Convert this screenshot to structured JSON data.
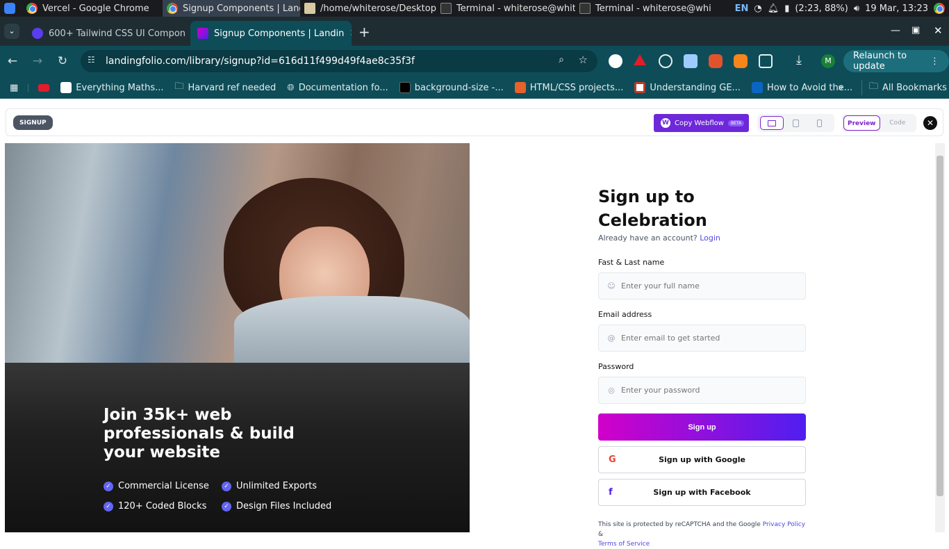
{
  "taskbar": {
    "apps": [
      {
        "label": "Vercel - Google Chrome"
      },
      {
        "label": "Signup Components | Landi..."
      },
      {
        "label": "/home/whiterose/Desktop/p..."
      },
      {
        "label": "Terminal - whiterose@white..."
      },
      {
        "label": "Terminal - whiterose@white..."
      }
    ],
    "lang": "EN",
    "battery": "(2:23, 88%)",
    "datetime": "19 Mar, 13:23"
  },
  "browser": {
    "tabs": [
      {
        "label": "600+ Tailwind CSS UI Compon"
      },
      {
        "label": "Signup Components | Landin"
      }
    ],
    "url": "landingfolio.com/library/signup?id=616d11f499d49f4ae8c35f3f",
    "relaunch": "Relaunch to update",
    "profile": "M",
    "bookmarks": [
      {
        "label": "Everything Maths..."
      },
      {
        "label": "Harvard ref needed"
      },
      {
        "label": "Documentation fo..."
      },
      {
        "label": "background-size -..."
      },
      {
        "label": "HTML/CSS projects..."
      },
      {
        "label": "Understanding GE..."
      },
      {
        "label": "How to Avoid the..."
      }
    ],
    "all_bookmarks": "All Bookmarks"
  },
  "preview_bar": {
    "tag": "SIGNUP",
    "webflow": "Copy Webflow",
    "beta": "BETA",
    "preview": "Preview",
    "code": "Code"
  },
  "hero": {
    "title": "Join 35k+ web professionals & build your website",
    "features": [
      "Commercial License",
      "Unlimited Exports",
      "120+ Coded Blocks",
      "Design Files Included"
    ]
  },
  "form": {
    "title": "Sign up to Celebration",
    "subtitle": "Already have an account?",
    "login": "Login",
    "name_label": "Fast & Last name",
    "name_placeholder": "Enter your full name",
    "email_label": "Email address",
    "email_placeholder": "Enter email to get started",
    "password_label": "Password",
    "password_placeholder": "Enter your password",
    "signup": "Sign up",
    "google": "Sign up with Google",
    "facebook": "Sign up with Facebook",
    "legal_pre": "This site is protected by reCAPTCHA and the Google",
    "privacy": "Privacy Policy",
    "amp": "&",
    "terms": "Terms of Service"
  },
  "colors": {
    "accent": "#6d28d9",
    "gradient_start": "#d100c9",
    "gradient_end": "#4f1ff0",
    "check": "#6366f1"
  }
}
